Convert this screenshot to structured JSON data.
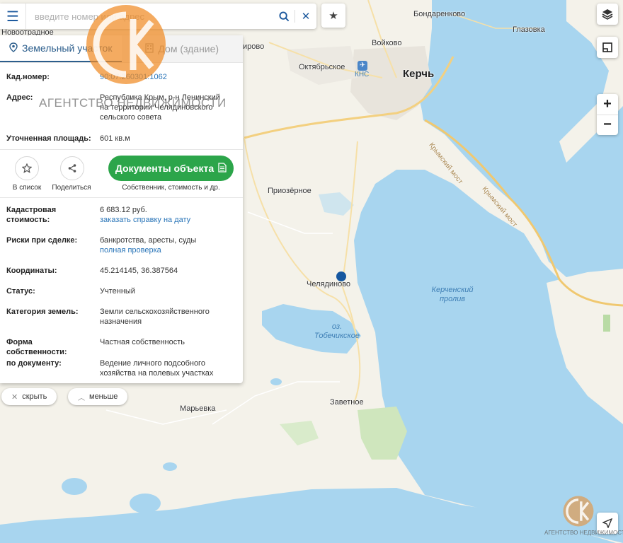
{
  "search": {
    "placeholder": "введите номер или адрес"
  },
  "map_labels": {
    "novootradnoe": "Новоотрадное",
    "kirovo": "ирово",
    "bondarenkovo": "Бондаренково",
    "voikovo": "Войково",
    "glazovka": "Глазовка",
    "oktyabrskoe": "Октябрьское",
    "kns": "КНС",
    "kerch": "Керчь",
    "bridge1": "Крымский мост",
    "bridge2": "Крымский мост",
    "priozernoe": "Приозёрное",
    "chelyadinovo": "Челядиново",
    "strait": "Керченский пролив",
    "lake": "оз. Тобечикское",
    "zavetnoe": "Заветное",
    "maryevka": "Марьевка"
  },
  "panel": {
    "tab_land": "Земельный участок",
    "tab_house": "Дом (здание)",
    "cad_number_label": "Кад.номер:",
    "cad_number_value": "90:07:260301:1062",
    "address_label": "Адрес:",
    "address_value": "Республика Крым, р-н Ленинский на территории Челядиновского сельского совета",
    "area_label": "Уточненная площадь:",
    "area_value": "601 кв.м",
    "to_list": "В список",
    "share": "Поделиться",
    "docs_button": "Документы объекта",
    "docs_caption": "Собственник, стоимость и др.",
    "cad_cost_label": "Кадастровая стоимость:",
    "cad_cost_value": "6 683.12 руб.",
    "cad_cost_link": "заказать справку на дату",
    "risks_label": "Риски при сделке:",
    "risks_value": "банкротства, аресты, суды",
    "risks_link": "полная проверка",
    "coords_label": "Координаты:",
    "coords_value": "45.214145, 36.387564",
    "status_label": "Статус:",
    "status_value": "Учтенный",
    "category_label": "Категория земель:",
    "category_value": "Земли сельскохозяйственного назначения",
    "ownership_label": "Форма собственности:",
    "ownership_value": "Частная собственность",
    "document_label": "по документу:",
    "document_value": "Ведение личного подсобного хозяйства на полевых участках"
  },
  "buttons": {
    "hide": "скрыть",
    "less": "меньше",
    "zoom_in": "+",
    "zoom_out": "−"
  },
  "watermark": {
    "text": "АГЕНТСТВО НЕДВИЖИМОСТИ",
    "small_text": "АГЕНТСТВО НЕДВИЖИМОСТИ"
  },
  "colors": {
    "accent": "#2c5e8c",
    "green": "#2ca54a",
    "marker": "#1557a0",
    "sea": "#a8d5ef",
    "land": "#f4f2ea",
    "watermark": "#f08a24"
  }
}
